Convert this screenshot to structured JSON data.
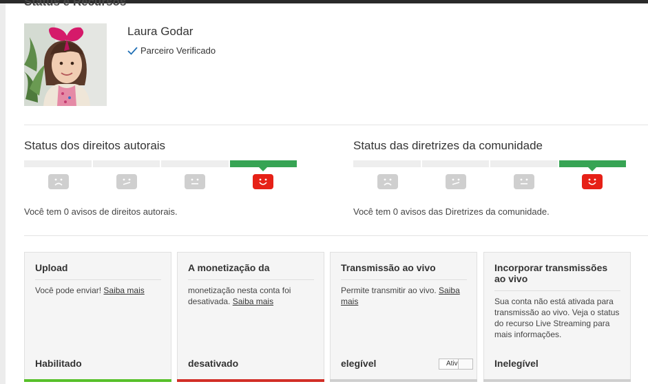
{
  "page": {
    "title": "Status e Recursos"
  },
  "channel": {
    "name": "Laura Godar",
    "verified_label": "Parceiro Verificado"
  },
  "copyright_status": {
    "title": "Status dos direitos autorais",
    "message": "Você tem 0 avisos de direitos autorais.",
    "level": 4,
    "level_max": 4
  },
  "community_status": {
    "title": "Status das diretrizes da comunidade",
    "message": "Você tem 0 avisos das Diretrizes da comunidade.",
    "level": 4,
    "level_max": 4
  },
  "colors": {
    "good": "#37a454",
    "happy_face": "#e62117",
    "neutral": "#cfcfcf"
  },
  "features": [
    {
      "title": "Upload",
      "text": "Você pode enviar! ",
      "link": "Saiba mais",
      "status": "Habilitado",
      "bar": "green"
    },
    {
      "title": "A monetização da",
      "text": "monetização nesta conta foi desativada. ",
      "link": "Saiba mais",
      "status": "desativado",
      "bar": "red"
    },
    {
      "title": "Transmissão ao vivo",
      "text": "Permite transmitir ao vivo. ",
      "link": "Saiba mais",
      "status": "elegível",
      "toggle_label": "Ativ",
      "bar": "gray"
    },
    {
      "title": "Incorporar transmissões ao vivo",
      "text": "Sua conta não está ativada para transmissão ao vivo. Veja o status do recurso Live Streaming para mais informações.",
      "link": "",
      "status": "Inelegível",
      "bar": "gray"
    }
  ]
}
